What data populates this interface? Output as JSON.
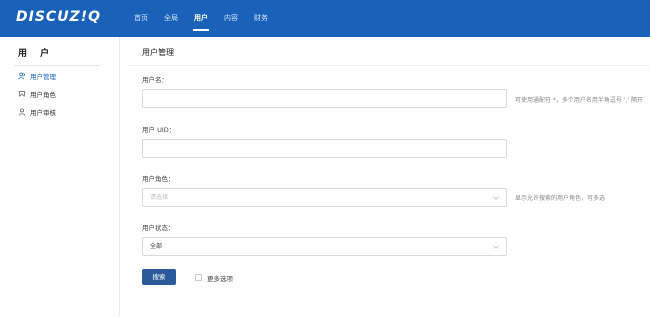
{
  "header": {
    "logo_text": "DISCUZ!Q",
    "nav": [
      {
        "label": "首页"
      },
      {
        "label": "全局"
      },
      {
        "label": "用户",
        "active": true
      },
      {
        "label": "内容"
      },
      {
        "label": "财务"
      }
    ]
  },
  "sidebar": {
    "title": "用 户",
    "items": [
      {
        "label": "用户管理",
        "icon": "users-icon",
        "active": true
      },
      {
        "label": "用户角色",
        "icon": "role-icon"
      },
      {
        "label": "用户审核",
        "icon": "user-review-icon"
      }
    ]
  },
  "main": {
    "title": "用户管理",
    "username": {
      "label": "用户名：",
      "value": "",
      "hint": "可使用通配符 *，多个用户名用半角逗号 ',' 隔开"
    },
    "uid": {
      "label": "用户 UID：",
      "value": ""
    },
    "role": {
      "label": "用户角色：",
      "placeholder": "请选择",
      "hint": "显示允许搜索的用户角色，可多选"
    },
    "status": {
      "label": "用户状态：",
      "value": "全部"
    },
    "search_button": "搜索",
    "more_options": {
      "label": "更多选项",
      "checked": false
    }
  },
  "colors": {
    "topbar": "#1a62b9",
    "primary_button": "#2a5a99",
    "active_link": "#1a62b9"
  }
}
